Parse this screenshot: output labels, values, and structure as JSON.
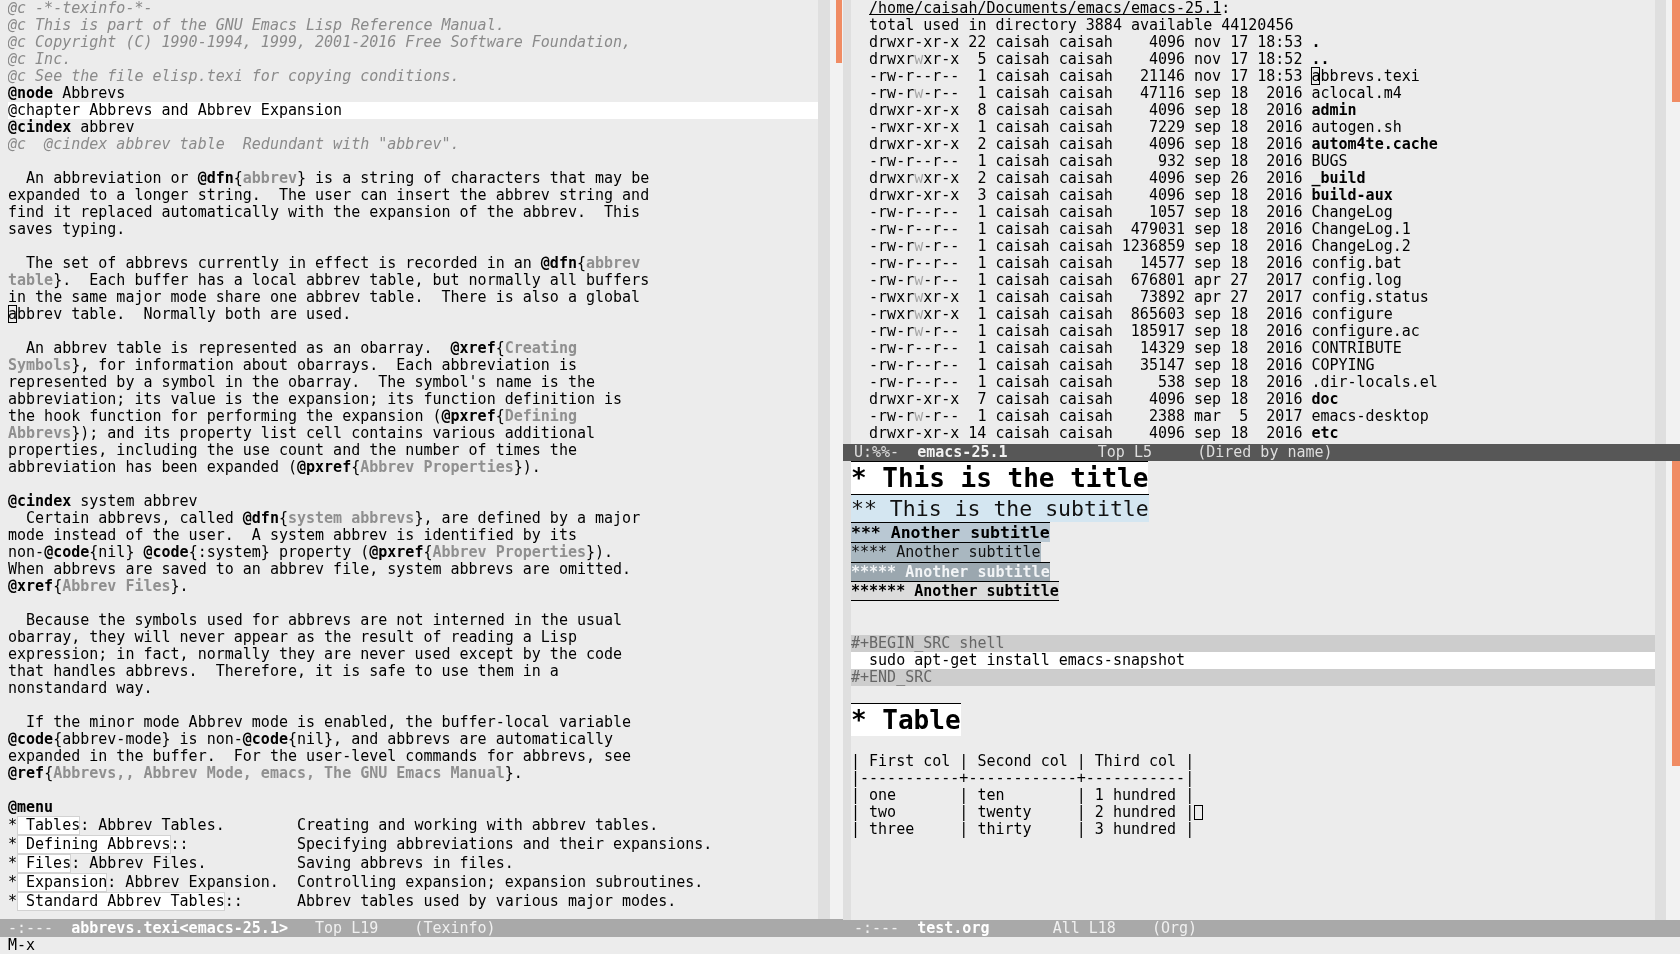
{
  "left_window": {
    "blocks": [
      {
        "kind": "text",
        "lines": [
          {
            "highlighted": false,
            "segments": [
              {
                "kind": "comment",
                "text": "@c -*-texinfo-*-"
              }
            ]
          },
          {
            "highlighted": false,
            "segments": [
              {
                "kind": "comment",
                "text": "@c This is part of the GNU Emacs Lisp Reference Manual."
              }
            ]
          },
          {
            "highlighted": false,
            "segments": [
              {
                "kind": "comment",
                "text": "@c Copyright (C) 1990-1994, 1999, 2001-2016 Free Software Foundation,"
              }
            ]
          },
          {
            "highlighted": false,
            "segments": [
              {
                "kind": "comment",
                "text": "@c Inc."
              }
            ]
          },
          {
            "highlighted": false,
            "segments": [
              {
                "kind": "comment",
                "text": "@c See the file elisp.texi for copying conditions."
              }
            ]
          },
          {
            "highlighted": false,
            "segments": [
              {
                "kind": "command",
                "text": "@node"
              },
              {
                "kind": "plain",
                "text": " Abbrevs"
              }
            ]
          },
          {
            "highlighted": true,
            "segments": [
              {
                "kind": "plain",
                "text": "@chapter Abbrevs and Abbrev Expansion"
              }
            ]
          },
          {
            "highlighted": false,
            "segments": [
              {
                "kind": "command",
                "text": "@cindex"
              },
              {
                "kind": "plain",
                "text": " abbrev"
              }
            ]
          },
          {
            "highlighted": false,
            "segments": [
              {
                "kind": "comment",
                "text": "@c  @cindex abbrev table  Redundant with \"abbrev\"."
              }
            ]
          }
        ]
      },
      {
        "kind": "text",
        "lines": [
          {
            "highlighted": false,
            "segments": [
              {
                "kind": "plain",
                "text": "  An abbreviation or "
              },
              {
                "kind": "command",
                "text": "@dfn"
              },
              {
                "kind": "plain",
                "text": "{"
              },
              {
                "kind": "argument",
                "text": "abbrev"
              },
              {
                "kind": "plain",
                "text": "} is a string of characters that may be"
              }
            ]
          },
          {
            "highlighted": false,
            "segments": [
              {
                "kind": "plain",
                "text": "expanded to a longer string.  The user can insert the abbrev string and"
              }
            ]
          },
          {
            "highlighted": false,
            "segments": [
              {
                "kind": "plain",
                "text": "find it replaced automatically with the expansion of the abbrev.  This"
              }
            ]
          },
          {
            "highlighted": false,
            "segments": [
              {
                "kind": "plain",
                "text": "saves typing."
              }
            ]
          }
        ]
      },
      {
        "kind": "text",
        "lines": [
          {
            "highlighted": false,
            "segments": [
              {
                "kind": "plain",
                "text": "  The set of abbrevs currently in effect is recorded in an "
              },
              {
                "kind": "command",
                "text": "@dfn"
              },
              {
                "kind": "plain",
                "text": "{"
              },
              {
                "kind": "argument",
                "text": "abbrev"
              }
            ]
          },
          {
            "highlighted": false,
            "segments": [
              {
                "kind": "argument",
                "text": "table"
              },
              {
                "kind": "plain",
                "text": "}.  Each buffer has a local abbrev table, but normally all buffers"
              }
            ]
          },
          {
            "highlighted": false,
            "segments": [
              {
                "kind": "plain",
                "text": "in the same major mode share one abbrev table.  There is also a global"
              }
            ]
          },
          {
            "highlighted": false,
            "segments": [
              {
                "kind": "cursor",
                "text": "a"
              },
              {
                "kind": "plain",
                "text": "bbrev table.  Normally both are used."
              }
            ]
          }
        ]
      },
      {
        "kind": "text",
        "lines": [
          {
            "highlighted": false,
            "segments": [
              {
                "kind": "plain",
                "text": "  An abbrev table is represented as an obarray.  "
              },
              {
                "kind": "command",
                "text": "@xref"
              },
              {
                "kind": "plain",
                "text": "{"
              },
              {
                "kind": "argument",
                "text": "Creating"
              }
            ]
          },
          {
            "highlighted": false,
            "segments": [
              {
                "kind": "argument",
                "text": "Symbols"
              },
              {
                "kind": "plain",
                "text": "}, for information about obarrays.  Each abbreviation is"
              }
            ]
          },
          {
            "highlighted": false,
            "segments": [
              {
                "kind": "plain",
                "text": "represented by a symbol in the obarray.  The symbol's name is the"
              }
            ]
          },
          {
            "highlighted": false,
            "segments": [
              {
                "kind": "plain",
                "text": "abbreviation; its value is the expansion; its function definition is"
              }
            ]
          },
          {
            "highlighted": false,
            "segments": [
              {
                "kind": "plain",
                "text": "the hook function for performing the expansion ("
              },
              {
                "kind": "command",
                "text": "@pxref"
              },
              {
                "kind": "plain",
                "text": "{"
              },
              {
                "kind": "argument",
                "text": "Defining"
              }
            ]
          },
          {
            "highlighted": false,
            "segments": [
              {
                "kind": "argument",
                "text": "Abbrevs"
              },
              {
                "kind": "plain",
                "text": "}); and its property list cell contains various additional"
              }
            ]
          },
          {
            "highlighted": false,
            "segments": [
              {
                "kind": "plain",
                "text": "properties, including the use count and the number of times the"
              }
            ]
          },
          {
            "highlighted": false,
            "segments": [
              {
                "kind": "plain",
                "text": "abbreviation has been expanded ("
              },
              {
                "kind": "command",
                "text": "@pxref"
              },
              {
                "kind": "plain",
                "text": "{"
              },
              {
                "kind": "argument",
                "text": "Abbrev Properties"
              },
              {
                "kind": "plain",
                "text": "})."
              }
            ]
          }
        ]
      },
      {
        "kind": "text",
        "lines": [
          {
            "highlighted": false,
            "segments": [
              {
                "kind": "command",
                "text": "@cindex"
              },
              {
                "kind": "plain",
                "text": " system abbrev"
              }
            ]
          },
          {
            "highlighted": false,
            "segments": [
              {
                "kind": "plain",
                "text": "  Certain abbrevs, called "
              },
              {
                "kind": "command",
                "text": "@dfn"
              },
              {
                "kind": "plain",
                "text": "{"
              },
              {
                "kind": "argument",
                "text": "system abbrevs"
              },
              {
                "kind": "plain",
                "text": "}, are defined by a major"
              }
            ]
          },
          {
            "highlighted": false,
            "segments": [
              {
                "kind": "plain",
                "text": "mode instead of the user.  A system abbrev is identified by its"
              }
            ]
          },
          {
            "highlighted": false,
            "segments": [
              {
                "kind": "plain",
                "text": "non-"
              },
              {
                "kind": "command",
                "text": "@code"
              },
              {
                "kind": "plain",
                "text": "{nil} "
              },
              {
                "kind": "command",
                "text": "@code"
              },
              {
                "kind": "plain",
                "text": "{:system} property ("
              },
              {
                "kind": "command",
                "text": "@pxref"
              },
              {
                "kind": "plain",
                "text": "{"
              },
              {
                "kind": "argument",
                "text": "Abbrev Properties"
              },
              {
                "kind": "plain",
                "text": "})."
              }
            ]
          },
          {
            "highlighted": false,
            "segments": [
              {
                "kind": "plain",
                "text": "When abbrevs are saved to an abbrev file, system abbrevs are omitted."
              }
            ]
          },
          {
            "highlighted": false,
            "segments": [
              {
                "kind": "command",
                "text": "@xref"
              },
              {
                "kind": "plain",
                "text": "{"
              },
              {
                "kind": "argument",
                "text": "Abbrev Files"
              },
              {
                "kind": "plain",
                "text": "}."
              }
            ]
          }
        ]
      },
      {
        "kind": "text",
        "lines": [
          {
            "highlighted": false,
            "segments": [
              {
                "kind": "plain",
                "text": "  Because the symbols used for abbrevs are not interned in the usual"
              }
            ]
          },
          {
            "highlighted": false,
            "segments": [
              {
                "kind": "plain",
                "text": "obarray, they will never appear as the result of reading a Lisp"
              }
            ]
          },
          {
            "highlighted": false,
            "segments": [
              {
                "kind": "plain",
                "text": "expression; in fact, normally they are never used except by the code"
              }
            ]
          },
          {
            "highlighted": false,
            "segments": [
              {
                "kind": "plain",
                "text": "that handles abbrevs.  Therefore, it is safe to use them in a"
              }
            ]
          },
          {
            "highlighted": false,
            "segments": [
              {
                "kind": "plain",
                "text": "nonstandard way."
              }
            ]
          }
        ]
      },
      {
        "kind": "text",
        "lines": [
          {
            "highlighted": false,
            "segments": [
              {
                "kind": "plain",
                "text": "  If the minor mode Abbrev mode is enabled, the buffer-local variable"
              }
            ]
          },
          {
            "highlighted": false,
            "segments": [
              {
                "kind": "command",
                "text": "@code"
              },
              {
                "kind": "plain",
                "text": "{abbrev-mode} is non-"
              },
              {
                "kind": "command",
                "text": "@code"
              },
              {
                "kind": "plain",
                "text": "{nil}, and abbrevs are automatically"
              }
            ]
          },
          {
            "highlighted": false,
            "segments": [
              {
                "kind": "plain",
                "text": "expanded in the buffer.  For the user-level commands for abbrevs, see"
              }
            ]
          },
          {
            "highlighted": false,
            "segments": [
              {
                "kind": "command",
                "text": "@ref"
              },
              {
                "kind": "plain",
                "text": "{"
              },
              {
                "kind": "argument",
                "text": "Abbrevs,, Abbrev Mode, emacs, The GNU Emacs Manual"
              },
              {
                "kind": "plain",
                "text": "}."
              }
            ]
          }
        ]
      },
      {
        "kind": "menu",
        "command": "@menu",
        "items": [
          {
            "marker": "*",
            "node": "Tables",
            "rest": ": Abbrev Tables.",
            "description": "Creating and working with abbrev tables."
          },
          {
            "marker": "*",
            "node": "Defining Abbrevs",
            "rest": "::",
            "description": "Specifying abbreviations and their expansions."
          },
          {
            "marker": "*",
            "node": "Files",
            "rest": ": Abbrev Files.",
            "description": "Saving abbrevs in files."
          },
          {
            "marker": "*",
            "node": "Expansion",
            "rest": ": Abbrev Expansion.",
            "description": "Controlling expansion; expansion subroutines."
          },
          {
            "marker": "*",
            "node": "Standard Abbrev Tables",
            "rest": "::",
            "description": "Abbrev tables used by various major modes."
          }
        ]
      }
    ],
    "mode_line": {
      "active": false,
      "status": "-:---",
      "buffer": "abbrevs.texi<emacs-25.1>",
      "position": "Top L19",
      "mode": "(Texinfo)"
    }
  },
  "dired_window": {
    "directory": "/home/caisah/Documents/emacs/emacs-25.1",
    "separator": ":",
    "summary": "total used in directory 3884 available 44120456",
    "entries": [
      {
        "permissions": "drwxr-xr-x",
        "group_writable": false,
        "links": "22",
        "owner": "caisah",
        "group": "caisah",
        "size": "4096",
        "date": "nov 17 18:53",
        "name": ".",
        "directory": true,
        "cursor": false
      },
      {
        "permissions": "drwxrwxr-x",
        "group_writable": true,
        "links": "5",
        "owner": "caisah",
        "group": "caisah",
        "size": "4096",
        "date": "nov 17 18:52",
        "name": "..",
        "directory": true,
        "cursor": false
      },
      {
        "permissions": "-rw-r--r--",
        "group_writable": false,
        "links": "1",
        "owner": "caisah",
        "group": "caisah",
        "size": "21146",
        "date": "nov 17 18:53",
        "name": "abbrevs.texi",
        "directory": false,
        "cursor": true
      },
      {
        "permissions": "-rw-rw-r--",
        "group_writable": true,
        "links": "1",
        "owner": "caisah",
        "group": "caisah",
        "size": "47116",
        "date": "sep 18  2016",
        "name": "aclocal.m4",
        "directory": false,
        "cursor": false
      },
      {
        "permissions": "drwxr-xr-x",
        "group_writable": false,
        "links": "8",
        "owner": "caisah",
        "group": "caisah",
        "size": "4096",
        "date": "sep 18  2016",
        "name": "admin",
        "directory": true,
        "cursor": false
      },
      {
        "permissions": "-rwxr-xr-x",
        "group_writable": false,
        "links": "1",
        "owner": "caisah",
        "group": "caisah",
        "size": "7229",
        "date": "sep 18  2016",
        "name": "autogen.sh",
        "directory": false,
        "cursor": false
      },
      {
        "permissions": "drwxr-xr-x",
        "group_writable": false,
        "links": "2",
        "owner": "caisah",
        "group": "caisah",
        "size": "4096",
        "date": "sep 18  2016",
        "name": "autom4te.cache",
        "directory": true,
        "cursor": false
      },
      {
        "permissions": "-rw-r--r--",
        "group_writable": false,
        "links": "1",
        "owner": "caisah",
        "group": "caisah",
        "size": "932",
        "date": "sep 18  2016",
        "name": "BUGS",
        "directory": false,
        "cursor": false
      },
      {
        "permissions": "drwxrwxr-x",
        "group_writable": true,
        "links": "2",
        "owner": "caisah",
        "group": "caisah",
        "size": "4096",
        "date": "sep 26  2016",
        "name": "_build",
        "directory": true,
        "cursor": false
      },
      {
        "permissions": "drwxr-xr-x",
        "group_writable": false,
        "links": "3",
        "owner": "caisah",
        "group": "caisah",
        "size": "4096",
        "date": "sep 18  2016",
        "name": "build-aux",
        "directory": true,
        "cursor": false
      },
      {
        "permissions": "-rw-r--r--",
        "group_writable": false,
        "links": "1",
        "owner": "caisah",
        "group": "caisah",
        "size": "1057",
        "date": "sep 18  2016",
        "name": "ChangeLog",
        "directory": false,
        "cursor": false
      },
      {
        "permissions": "-rw-r--r--",
        "group_writable": false,
        "links": "1",
        "owner": "caisah",
        "group": "caisah",
        "size": "479031",
        "date": "sep 18  2016",
        "name": "ChangeLog.1",
        "directory": false,
        "cursor": false
      },
      {
        "permissions": "-rw-rw-r--",
        "group_writable": true,
        "links": "1",
        "owner": "caisah",
        "group": "caisah",
        "size": "1236859",
        "date": "sep 18  2016",
        "name": "ChangeLog.2",
        "directory": false,
        "cursor": false
      },
      {
        "permissions": "-rw-r--r--",
        "group_writable": false,
        "links": "1",
        "owner": "caisah",
        "group": "caisah",
        "size": "14577",
        "date": "sep 18  2016",
        "name": "config.bat",
        "directory": false,
        "cursor": false
      },
      {
        "permissions": "-rw-rw-r--",
        "group_writable": true,
        "links": "1",
        "owner": "caisah",
        "group": "caisah",
        "size": "676801",
        "date": "apr 27  2017",
        "name": "config.log",
        "directory": false,
        "cursor": false
      },
      {
        "permissions": "-rwxrwxr-x",
        "group_writable": true,
        "links": "1",
        "owner": "caisah",
        "group": "caisah",
        "size": "73892",
        "date": "apr 27  2017",
        "name": "config.status",
        "directory": false,
        "cursor": false
      },
      {
        "permissions": "-rwxrwxr-x",
        "group_writable": true,
        "links": "1",
        "owner": "caisah",
        "group": "caisah",
        "size": "865603",
        "date": "sep 18  2016",
        "name": "configure",
        "directory": false,
        "cursor": false
      },
      {
        "permissions": "-rw-rw-r--",
        "group_writable": true,
        "links": "1",
        "owner": "caisah",
        "group": "caisah",
        "size": "185917",
        "date": "sep 18  2016",
        "name": "configure.ac",
        "directory": false,
        "cursor": false
      },
      {
        "permissions": "-rw-r--r--",
        "group_writable": false,
        "links": "1",
        "owner": "caisah",
        "group": "caisah",
        "size": "14329",
        "date": "sep 18  2016",
        "name": "CONTRIBUTE",
        "directory": false,
        "cursor": false
      },
      {
        "permissions": "-rw-r--r--",
        "group_writable": false,
        "links": "1",
        "owner": "caisah",
        "group": "caisah",
        "size": "35147",
        "date": "sep 18  2016",
        "name": "COPYING",
        "directory": false,
        "cursor": false
      },
      {
        "permissions": "-rw-r--r--",
        "group_writable": false,
        "links": "1",
        "owner": "caisah",
        "group": "caisah",
        "size": "538",
        "date": "sep 18  2016",
        "name": ".dir-locals.el",
        "directory": false,
        "cursor": false
      },
      {
        "permissions": "drwxr-xr-x",
        "group_writable": false,
        "links": "7",
        "owner": "caisah",
        "group": "caisah",
        "size": "4096",
        "date": "sep 18  2016",
        "name": "doc",
        "directory": true,
        "cursor": false
      },
      {
        "permissions": "-rw-rw-r--",
        "group_writable": true,
        "links": "1",
        "owner": "caisah",
        "group": "caisah",
        "size": "2388",
        "date": "mar  5  2017",
        "name": "emacs-desktop",
        "directory": false,
        "cursor": false
      },
      {
        "permissions": "drwxr-xr-x",
        "group_writable": false,
        "links": "14",
        "owner": "caisah",
        "group": "caisah",
        "size": "4096",
        "date": "sep 18  2016",
        "name": "etc",
        "directory": true,
        "cursor": false
      }
    ],
    "mode_line": {
      "active": true,
      "status": "U:%%-",
      "buffer": "emacs-25.1",
      "position": "Top L5",
      "mode": "(Dired by name)"
    }
  },
  "org_window": {
    "outline": [
      {
        "heading": "* This is the title",
        "children": [
          {
            "heading": "** This is the subtitle",
            "children": [
              {
                "heading": "*** Another subtitle",
                "children": [
                  {
                    "heading": "**** Another subtitle",
                    "children": [
                      {
                        "heading": "***** Another subtitle",
                        "children": [
                          {
                            "heading": "****** Another subtitle",
                            "source_block": {
                              "begin": "#+BEGIN_SRC shell",
                              "code": [
                                "sudo apt-get install emacs-snapshot"
                              ],
                              "end": "#+END_SRC"
                            }
                          }
                        ]
                      }
                    ]
                  }
                ]
              }
            ]
          }
        ]
      },
      {
        "heading": "* Table",
        "table": {
          "lines": [
            {
              "text": "| First col | Second col | Third col |",
              "cursor": false
            },
            {
              "text": "|-----------+------------+-----------|",
              "cursor": false
            },
            {
              "text": "| one       | ten        | 1 hundred |",
              "cursor": false
            },
            {
              "text": "| two       | twenty     | 2 hundred |",
              "cursor": true
            },
            {
              "text": "| three     | thirty     | 3 hundred |",
              "cursor": false
            }
          ]
        }
      }
    ],
    "mode_line": {
      "active": false,
      "status": "-:---",
      "buffer": "test.org",
      "position": "All L18",
      "mode": "(Org)"
    }
  },
  "minibuffer": {
    "text": "M-x"
  }
}
